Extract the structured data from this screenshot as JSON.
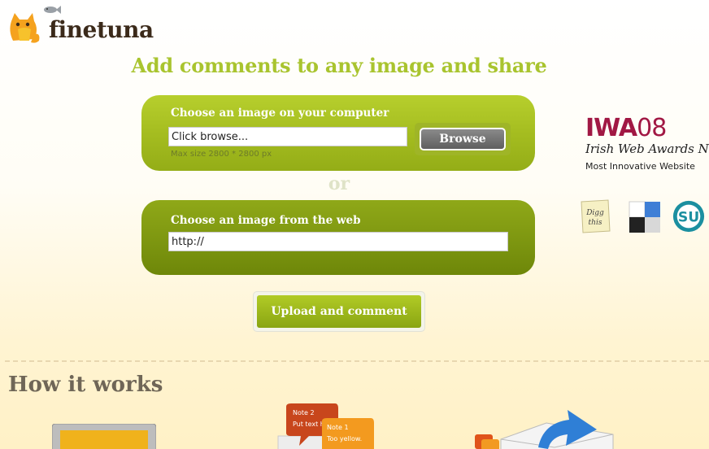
{
  "brand": {
    "name": "finetuna"
  },
  "headline": "Add comments to any image and share",
  "upload_panel": {
    "label": "Choose an image on your computer",
    "file_input_value": "Click browse...",
    "browse_label": "Browse",
    "hint": "Max size 2800 * 2800 px"
  },
  "or_text": "or",
  "web_panel": {
    "label": "Choose an image from the web",
    "url_input_value": "http://"
  },
  "upload_button_label": "Upload and comment",
  "how_it_works": {
    "title": "How it works"
  },
  "award": {
    "top": "IWA",
    "year": "08",
    "script": "Irish Web Awards Nominee",
    "subtitle": "Most Innovative Website"
  },
  "social": {
    "digg": "Digg this",
    "items": [
      "digg-icon",
      "delicious-icon",
      "stumbleupon-icon"
    ]
  },
  "notes": {
    "note2_title": "Note 2",
    "note2_text": "Put text he",
    "note1_title": "Note 1",
    "note1_text": "Too yellow."
  },
  "colors": {
    "accent": "#a9c42f",
    "panel_green": "#a5bd20",
    "panel_dark": "#7f9811",
    "award": "#a11844"
  }
}
